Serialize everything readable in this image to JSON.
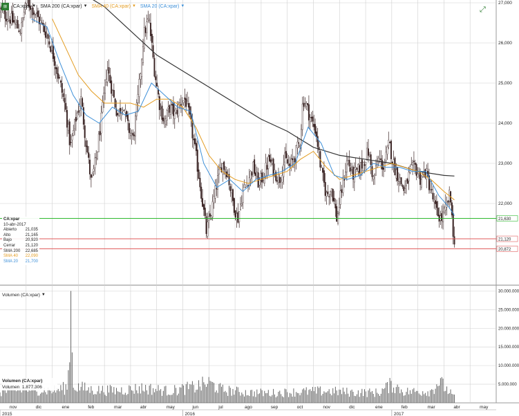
{
  "legend": [
    {
      "label": "CA:xpar",
      "color": "#222222"
    },
    {
      "label": "SMA 200 (CA:xpar)",
      "color": "#222222"
    },
    {
      "label": "SMA 40 (CA:xpar)",
      "color": "#e39b1f"
    },
    {
      "label": "SMA 20 (CA:xpar)",
      "color": "#3c8fd8"
    }
  ],
  "info_box": {
    "symbol": "CA:xpar",
    "date": "10-abr-2017",
    "rows": [
      {
        "label": "Abierto",
        "value": "21,035"
      },
      {
        "label": "Alto",
        "value": "21,165"
      },
      {
        "label": "Bajo",
        "value": "20,920"
      },
      {
        "label": "Cerrar",
        "value": "21,120"
      },
      {
        "label": "SMA 200",
        "value": "22,685"
      },
      {
        "label": "SMA 40",
        "value": "22,090"
      },
      {
        "label": "SMA 20",
        "value": "21,700"
      }
    ]
  },
  "volume_panel": {
    "legend": "Volumen (CA:xpar)",
    "info_title": "Volumen (CA:xpar)",
    "info_label": "Volumen",
    "info_value": "1.877.306"
  },
  "colors": {
    "candle": "#3a2424",
    "sma200": "#333333",
    "sma40": "#e39b1f",
    "sma20": "#3c8fd8",
    "volume": "#666666",
    "hline_green": "#2eb82e",
    "hline_red": "#e05a5a",
    "grid": "#d0d0d0"
  },
  "chart_data": [
    {
      "type": "line",
      "title": "CA:xpar",
      "ylim": [
        20.0,
        27.0
      ],
      "y_ticks": [
        {
          "value": 27,
          "label": "27,000"
        },
        {
          "value": 26,
          "label": "26,000"
        },
        {
          "value": 25,
          "label": "25,000"
        },
        {
          "value": 24,
          "label": "24,000"
        },
        {
          "value": 23,
          "label": "23,000"
        },
        {
          "value": 22,
          "label": "22,000"
        }
      ],
      "x_months": [
        {
          "label": "nov",
          "t": 0.5
        },
        {
          "label": "dic",
          "t": 1.5
        },
        {
          "label": "ene",
          "t": 2.5
        },
        {
          "label": "feb",
          "t": 3.5
        },
        {
          "label": "mar",
          "t": 4.5
        },
        {
          "label": "abr",
          "t": 5.5
        },
        {
          "label": "may",
          "t": 6.5
        },
        {
          "label": "jun",
          "t": 7.5
        },
        {
          "label": "jul",
          "t": 8.5
        },
        {
          "label": "ago",
          "t": 9.5
        },
        {
          "label": "sep",
          "t": 10.5
        },
        {
          "label": "oct",
          "t": 11.5
        },
        {
          "label": "nov",
          "t": 12.5
        },
        {
          "label": "dic",
          "t": 13.5
        },
        {
          "label": "ene",
          "t": 14.5
        },
        {
          "label": "feb",
          "t": 15.5
        },
        {
          "label": "mar",
          "t": 16.5
        },
        {
          "label": "abr",
          "t": 17.5
        },
        {
          "label": "may",
          "t": 18.5
        }
      ],
      "x_years": [
        {
          "label": "2015",
          "t": 0.0
        },
        {
          "label": "2016",
          "t": 7.0
        },
        {
          "label": "2017",
          "t": 15.0
        }
      ],
      "price_keypoints": [
        [
          0.0,
          26.8
        ],
        [
          0.4,
          26.6
        ],
        [
          0.8,
          26.3
        ],
        [
          1.0,
          27.1
        ],
        [
          1.3,
          26.8
        ],
        [
          1.8,
          26.2
        ],
        [
          2.0,
          25.8
        ],
        [
          2.3,
          25.0
        ],
        [
          2.5,
          24.4
        ],
        [
          2.7,
          23.4
        ],
        [
          2.9,
          24.1
        ],
        [
          3.1,
          24.6
        ],
        [
          3.3,
          23.5
        ],
        [
          3.5,
          22.5
        ],
        [
          3.7,
          23.2
        ],
        [
          3.9,
          24.2
        ],
        [
          4.1,
          25.4
        ],
        [
          4.3,
          24.8
        ],
        [
          4.5,
          24.2
        ],
        [
          4.7,
          24.5
        ],
        [
          4.9,
          23.9
        ],
        [
          5.1,
          23.6
        ],
        [
          5.3,
          24.7
        ],
        [
          5.5,
          26.2
        ],
        [
          5.7,
          26.6
        ],
        [
          5.9,
          25.4
        ],
        [
          6.1,
          24.5
        ],
        [
          6.3,
          24.0
        ],
        [
          6.5,
          24.4
        ],
        [
          6.7,
          24.2
        ],
        [
          6.9,
          24.5
        ],
        [
          7.1,
          24.6
        ],
        [
          7.3,
          24.0
        ],
        [
          7.5,
          23.2
        ],
        [
          7.7,
          22.3
        ],
        [
          7.9,
          21.3
        ],
        [
          8.1,
          21.8
        ],
        [
          8.3,
          22.5
        ],
        [
          8.5,
          23.0
        ],
        [
          8.7,
          22.8
        ],
        [
          8.9,
          22.1
        ],
        [
          9.1,
          21.6
        ],
        [
          9.3,
          22.3
        ],
        [
          9.5,
          22.6
        ],
        [
          9.7,
          22.9
        ],
        [
          9.9,
          22.5
        ],
        [
          10.1,
          22.7
        ],
        [
          10.3,
          23.1
        ],
        [
          10.5,
          22.8
        ],
        [
          10.7,
          22.6
        ],
        [
          10.9,
          23.1
        ],
        [
          11.1,
          22.9
        ],
        [
          11.3,
          23.2
        ],
        [
          11.5,
          23.6
        ],
        [
          11.6,
          24.6
        ],
        [
          11.7,
          24.5
        ],
        [
          11.9,
          24.1
        ],
        [
          12.1,
          23.8
        ],
        [
          12.3,
          22.8
        ],
        [
          12.5,
          22.2
        ],
        [
          12.7,
          22.4
        ],
        [
          12.9,
          21.6
        ],
        [
          13.1,
          22.4
        ],
        [
          13.3,
          23.1
        ],
        [
          13.5,
          22.7
        ],
        [
          13.7,
          22.8
        ],
        [
          13.9,
          23.0
        ],
        [
          14.1,
          23.3
        ],
        [
          14.3,
          22.6
        ],
        [
          14.5,
          23.1
        ],
        [
          14.7,
          22.9
        ],
        [
          14.9,
          23.5
        ],
        [
          15.1,
          22.9
        ],
        [
          15.3,
          22.6
        ],
        [
          15.5,
          22.3
        ],
        [
          15.7,
          22.8
        ],
        [
          15.9,
          22.9
        ],
        [
          16.1,
          22.6
        ],
        [
          16.3,
          22.8
        ],
        [
          16.5,
          22.3
        ],
        [
          16.7,
          21.8
        ],
        [
          16.9,
          21.6
        ],
        [
          17.1,
          21.9
        ],
        [
          17.2,
          22.2
        ],
        [
          17.3,
          21.9
        ],
        [
          17.35,
          21.1
        ],
        [
          17.4,
          21.12
        ]
      ],
      "series": [
        {
          "name": "SMA 200 (CA:xpar)",
          "color": "#333333",
          "points": [
            [
              3.0,
              27.3
            ],
            [
              4.0,
              26.9
            ],
            [
              5.0,
              26.3
            ],
            [
              6.0,
              25.7
            ],
            [
              7.0,
              25.3
            ],
            [
              8.0,
              24.9
            ],
            [
              9.0,
              24.5
            ],
            [
              10.0,
              24.1
            ],
            [
              11.0,
              23.8
            ],
            [
              12.0,
              23.4
            ],
            [
              13.0,
              23.2
            ],
            [
              14.0,
              23.1
            ],
            [
              15.0,
              23.0
            ],
            [
              16.0,
              22.8
            ],
            [
              17.0,
              22.7
            ],
            [
              17.4,
              22.685
            ]
          ]
        },
        {
          "name": "SMA 40 (CA:xpar)",
          "color": "#e39b1f",
          "points": [
            [
              2.0,
              26.6
            ],
            [
              2.5,
              25.9
            ],
            [
              3.0,
              25.2
            ],
            [
              3.5,
              24.8
            ],
            [
              4.0,
              24.5
            ],
            [
              4.5,
              24.5
            ],
            [
              5.0,
              24.5
            ],
            [
              5.5,
              24.4
            ],
            [
              6.0,
              24.6
            ],
            [
              6.5,
              24.6
            ],
            [
              7.0,
              24.4
            ],
            [
              7.5,
              23.9
            ],
            [
              8.0,
              23.2
            ],
            [
              8.5,
              22.8
            ],
            [
              9.0,
              22.6
            ],
            [
              9.5,
              22.5
            ],
            [
              10.0,
              22.6
            ],
            [
              10.5,
              22.7
            ],
            [
              11.0,
              22.8
            ],
            [
              11.5,
              23.1
            ],
            [
              12.0,
              23.3
            ],
            [
              12.5,
              22.9
            ],
            [
              13.0,
              22.6
            ],
            [
              13.5,
              22.7
            ],
            [
              14.0,
              22.8
            ],
            [
              14.5,
              22.9
            ],
            [
              15.0,
              23.0
            ],
            [
              15.5,
              22.9
            ],
            [
              16.0,
              22.8
            ],
            [
              16.5,
              22.6
            ],
            [
              17.0,
              22.3
            ],
            [
              17.4,
              22.09
            ]
          ]
        },
        {
          "name": "SMA 20 (CA:xpar)",
          "color": "#3c8fd8",
          "points": [
            [
              1.2,
              26.6
            ],
            [
              1.8,
              26.4
            ],
            [
              2.3,
              25.5
            ],
            [
              2.8,
              24.7
            ],
            [
              3.3,
              24.2
            ],
            [
              3.8,
              24.0
            ],
            [
              4.3,
              24.4
            ],
            [
              4.8,
              24.2
            ],
            [
              5.3,
              24.3
            ],
            [
              5.8,
              25.0
            ],
            [
              6.3,
              24.7
            ],
            [
              6.8,
              24.4
            ],
            [
              7.3,
              24.3
            ],
            [
              7.8,
              23.0
            ],
            [
              8.3,
              22.4
            ],
            [
              8.8,
              22.6
            ],
            [
              9.3,
              22.3
            ],
            [
              9.8,
              22.6
            ],
            [
              10.3,
              22.7
            ],
            [
              10.8,
              22.8
            ],
            [
              11.3,
              23.0
            ],
            [
              11.8,
              23.9
            ],
            [
              12.3,
              23.5
            ],
            [
              12.8,
              22.7
            ],
            [
              13.3,
              22.6
            ],
            [
              13.8,
              22.7
            ],
            [
              14.3,
              23.0
            ],
            [
              14.8,
              22.9
            ],
            [
              15.3,
              22.9
            ],
            [
              15.8,
              22.8
            ],
            [
              16.3,
              22.8
            ],
            [
              16.8,
              22.2
            ],
            [
              17.2,
              21.9
            ],
            [
              17.4,
              21.7
            ]
          ]
        }
      ],
      "horizontal_lines": [
        {
          "value": 21.63,
          "label": "21,630",
          "color": "#2eb82e"
        },
        {
          "value": 21.12,
          "label": "21,120",
          "color": "#e05a5a"
        },
        {
          "value": 20.872,
          "label": "20,872",
          "color": "#e05a5a"
        }
      ]
    },
    {
      "type": "bar",
      "title": "Volumen (CA:xpar)",
      "ylim": [
        0,
        31000000
      ],
      "y_ticks": [
        {
          "value": 30000000,
          "label": "30.000.000"
        },
        {
          "value": 25000000,
          "label": "25.000.000"
        },
        {
          "value": 20000000,
          "label": "20.000.000"
        },
        {
          "value": 15000000,
          "label": "15.000.000"
        },
        {
          "value": 10000000,
          "label": "10.000.000"
        },
        {
          "value": 5000000,
          "label": "5.000.000"
        }
      ],
      "volume_keypoints": [
        [
          0.0,
          3500000
        ],
        [
          1.0,
          4500000
        ],
        [
          2.0,
          4000000
        ],
        [
          2.6,
          5000000
        ],
        [
          2.7,
          30000000
        ],
        [
          2.8,
          5500000
        ],
        [
          3.5,
          4200000
        ],
        [
          4.5,
          4000000
        ],
        [
          5.5,
          4800000
        ],
        [
          6.5,
          3800000
        ],
        [
          7.5,
          5200000
        ],
        [
          8.0,
          6500000
        ],
        [
          8.5,
          4200000
        ],
        [
          9.5,
          3300000
        ],
        [
          10.5,
          3200000
        ],
        [
          11.5,
          3600000
        ],
        [
          12.5,
          3800000
        ],
        [
          13.5,
          3400000
        ],
        [
          14.5,
          3300000
        ],
        [
          15.0,
          6000000
        ],
        [
          15.5,
          3600000
        ],
        [
          16.5,
          3800000
        ],
        [
          16.8,
          7000000
        ],
        [
          17.4,
          1877306
        ]
      ],
      "last_value": 1877306
    }
  ]
}
